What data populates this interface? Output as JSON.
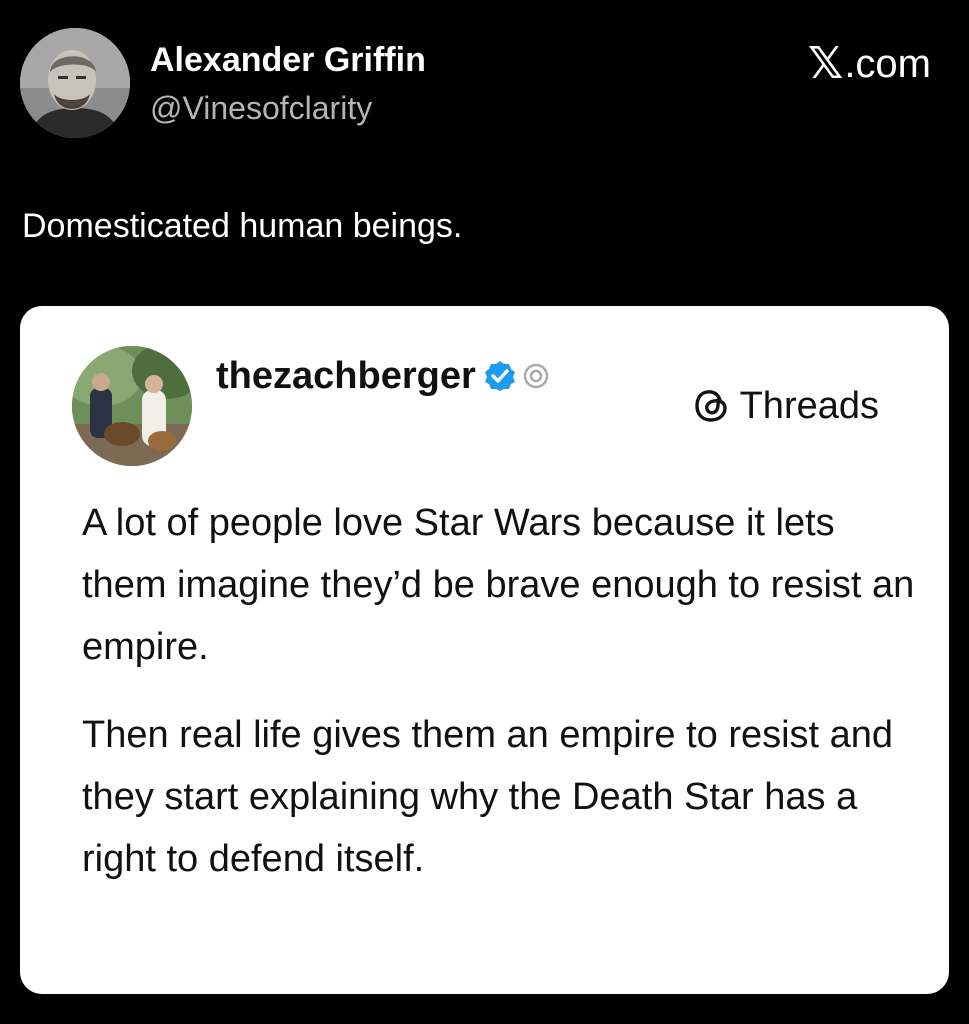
{
  "tweet": {
    "author": {
      "name": "Alexander Griffin",
      "handle": "@Vinesofclarity",
      "avatar_icon": "person-avatar"
    },
    "brand": {
      "symbol": "𝕏",
      "suffix": ".com"
    },
    "text": "Domesticated human beings."
  },
  "quoted_post": {
    "platform_label": "Threads",
    "author": {
      "name": "thezachberger",
      "verified": true,
      "avatar_icon": "person-with-dogs-avatar"
    },
    "paragraphs": [
      "A lot of people love Star Wars because it lets them imagine they’d be brave enough to resist an empire.",
      "Then real life gives them an empire to resist and they start explaining why the Death Star has a right to defend itself."
    ]
  },
  "colors": {
    "background": "#000000",
    "card_background": "#ffffff",
    "handle_gray": "#b4b4b4",
    "verified_blue": "#1d9bf0"
  }
}
